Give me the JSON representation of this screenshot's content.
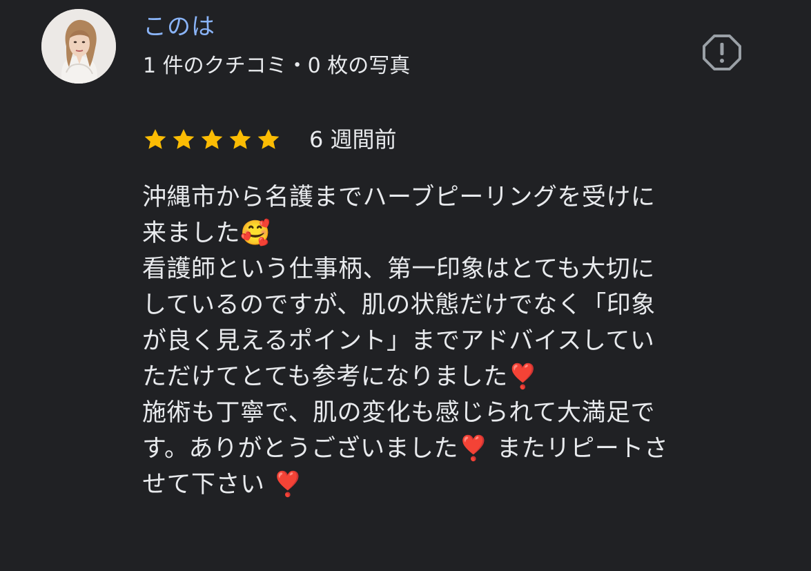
{
  "reviewer": {
    "name": "このは",
    "meta": "1 件のクチコミ・0 枚の写真"
  },
  "review": {
    "rating": 5,
    "max_rating": 5,
    "date": "6 週間前",
    "lines": [
      "沖縄市から名護までハーブピーリングを受けに",
      "来ました🥰",
      "看護師という仕事柄、第一印象はとても大切に",
      "しているのですが、肌の状態だけでなく「印象",
      "が良く見えるポイント」までアドバイスしてい",
      "ただけてとても参考になりました❣️",
      "施術も丁寧で、肌の変化も感じられて大満足で",
      "す。ありがとうございました❣️ またリピートさ",
      "せて下さい ❣️"
    ]
  },
  "icons": {
    "report": "report-octagon-icon",
    "star": "star-icon"
  },
  "colors": {
    "background": "#202124",
    "name_link": "#8ab4f8",
    "text": "#e8eaed",
    "star": "#fbbc04",
    "report_icon": "#9aa0a6"
  }
}
